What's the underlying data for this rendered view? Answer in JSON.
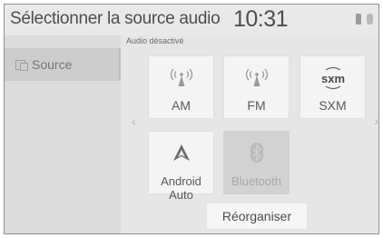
{
  "header": {
    "title": "Sélectionner la source audio",
    "clock": "10:31"
  },
  "sidebar": {
    "items": [
      {
        "label": "Source",
        "icon": "source-icon"
      }
    ]
  },
  "main": {
    "status_text": "Audio désactivé",
    "tiles": [
      {
        "label": "AM",
        "icon": "radio-signal-icon",
        "enabled": true
      },
      {
        "label": "FM",
        "icon": "radio-signal-icon",
        "enabled": true
      },
      {
        "label": "SXM",
        "icon": "sxm-logo-icon",
        "enabled": true
      },
      {
        "label": "Android Auto",
        "icon": "android-auto-icon",
        "enabled": true
      },
      {
        "label": "Bluetooth",
        "icon": "bluetooth-icon",
        "enabled": false
      }
    ],
    "reorganize_label": "Réorganiser"
  },
  "colors": {
    "background": "#e6e6e6",
    "tile": "#f4f4f4",
    "tile_disabled": "#d2d2d2",
    "text": "#4e4e4e"
  }
}
